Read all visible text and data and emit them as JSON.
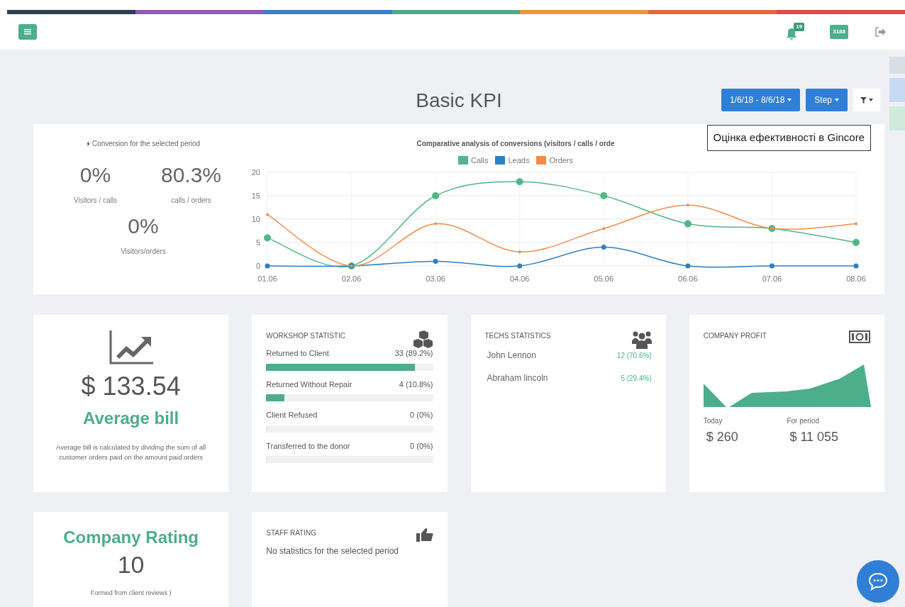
{
  "header": {
    "notifications_badge": "19",
    "money_badge": "3188"
  },
  "page": {
    "title": "Basic KPI",
    "date_button": "1/6/18 - 8/6/18",
    "step_button": "Step",
    "tooltip": "Оцінка ефективності в Gincore"
  },
  "conversion": {
    "title": "Conversion for the selected period",
    "items": [
      {
        "value": "0%",
        "label": "Visitors / calls"
      },
      {
        "value": "80.3%",
        "label": "calls / orders"
      },
      {
        "value": "0%",
        "label": "Visitors/orders"
      }
    ]
  },
  "chart": {
    "chart_data": {
      "type": "line",
      "grid": true,
      "legend": true,
      "title": "Comparative analysis of conversions (visitors / calls / orde",
      "categories": [
        "01.06",
        "02.06",
        "03.06",
        "04.06",
        "05.06",
        "06.06",
        "07.06",
        "08.06"
      ],
      "ylim": [
        0,
        20
      ],
      "yticks": [
        0,
        5,
        10,
        15,
        20
      ],
      "series": [
        {
          "name": "Calls",
          "color": "#52b788",
          "marker": true,
          "values": [
            6,
            0,
            15,
            18,
            15,
            9,
            8,
            5
          ]
        },
        {
          "name": "Leads",
          "color": "#2f7fc1",
          "marker": true,
          "values": [
            0,
            0,
            1,
            0,
            4,
            0,
            0,
            0
          ]
        },
        {
          "name": "Orders",
          "color": "#f08c4a",
          "marker": true,
          "values": [
            11,
            0,
            9,
            3,
            8,
            13,
            8,
            9
          ]
        }
      ]
    }
  },
  "average_bill": {
    "amount": "$ 133.54",
    "title": "Average bill",
    "description": "Average bill is calculated by dividing the sum of all customer orders paid on the amount paid orders"
  },
  "workshop": {
    "title": "WORKSHOP STATISTIC",
    "rows": [
      {
        "label": "Returned to Client",
        "value": "33 (89.2%)",
        "level": 0.892
      },
      {
        "label": "Returned Without Repair",
        "value": "4 (10.8%)",
        "level": 0.108
      },
      {
        "label": "Client Refused",
        "value": "0 (0%)",
        "level": 0
      },
      {
        "label": "Transferred to the donor",
        "value": "0 (0%)",
        "level": 0
      }
    ]
  },
  "techs": {
    "title": "TECHS STATISTICS",
    "rows": [
      {
        "name": "John Lennon",
        "value": "12 (70.6%)"
      },
      {
        "name": "Abraham lincoln",
        "value": "5 (29.4%)"
      }
    ]
  },
  "profit": {
    "title": "COMPANY PROFIT",
    "today_label": "Today",
    "today_value": "$ 260",
    "period_label": "For period",
    "period_value": "$ 11 055"
  },
  "rating": {
    "title": "Company Rating",
    "value": "10",
    "note": "Formed from client reviews )"
  },
  "staff": {
    "title": "STAFF RATING",
    "message": "No statistics for the selected period"
  }
}
